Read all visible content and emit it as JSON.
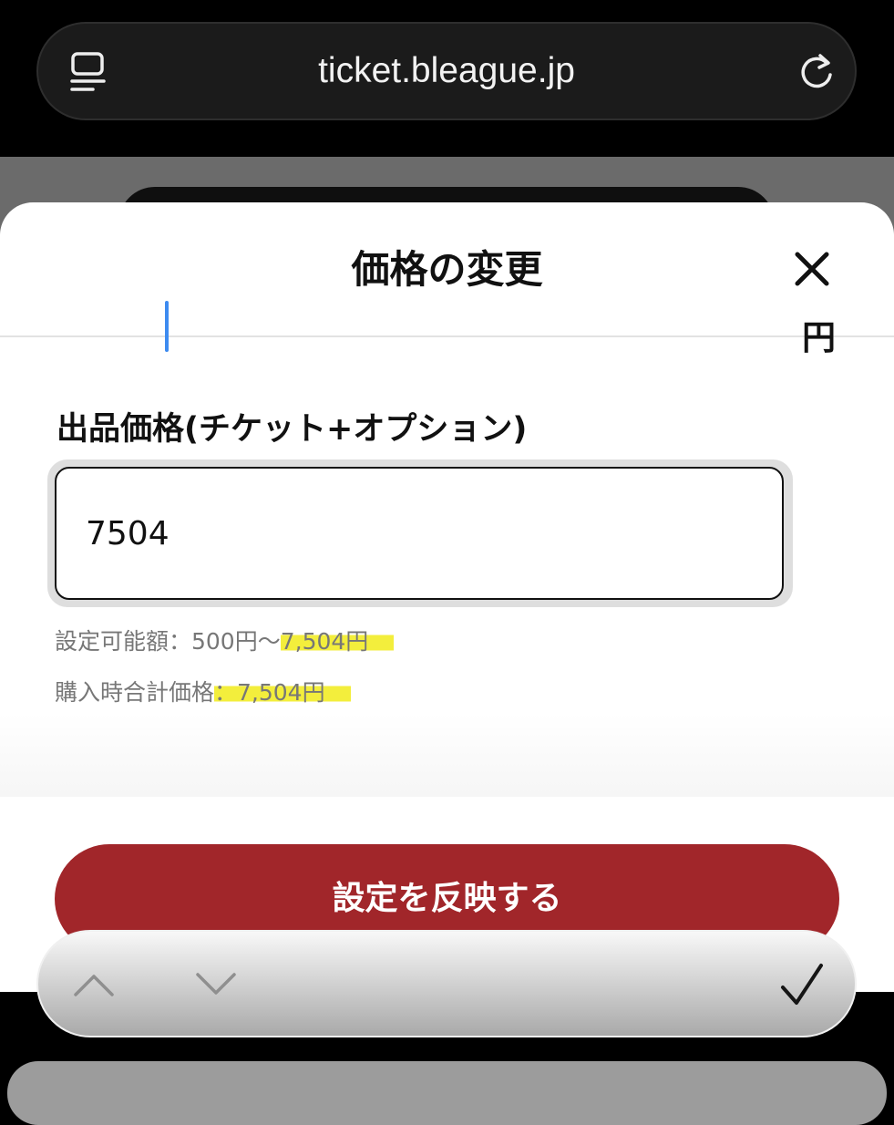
{
  "browser": {
    "url": "ticket.bleague.jp",
    "tabs_icon": "tabs-icon",
    "reload_icon": "reload-icon"
  },
  "sheet": {
    "title": "価格の変更",
    "close_icon": "close-icon",
    "field_label": "出品価格(チケット+オプション)",
    "price_value": "7504",
    "unit": "円",
    "range_prefix": "設定可能額：500円〜",
    "range_max": "7,504円",
    "total_prefix": "購入時合計価格",
    "total_value": "：7,504円",
    "apply_label": "設定を反映する",
    "highlight_color": "#f3ee3c",
    "button_color": "#a1262a"
  },
  "keyboard_accessory": {
    "previous_icon": "chevron-up-icon",
    "next_icon": "chevron-down-icon",
    "done_icon": "checkmark-icon"
  }
}
